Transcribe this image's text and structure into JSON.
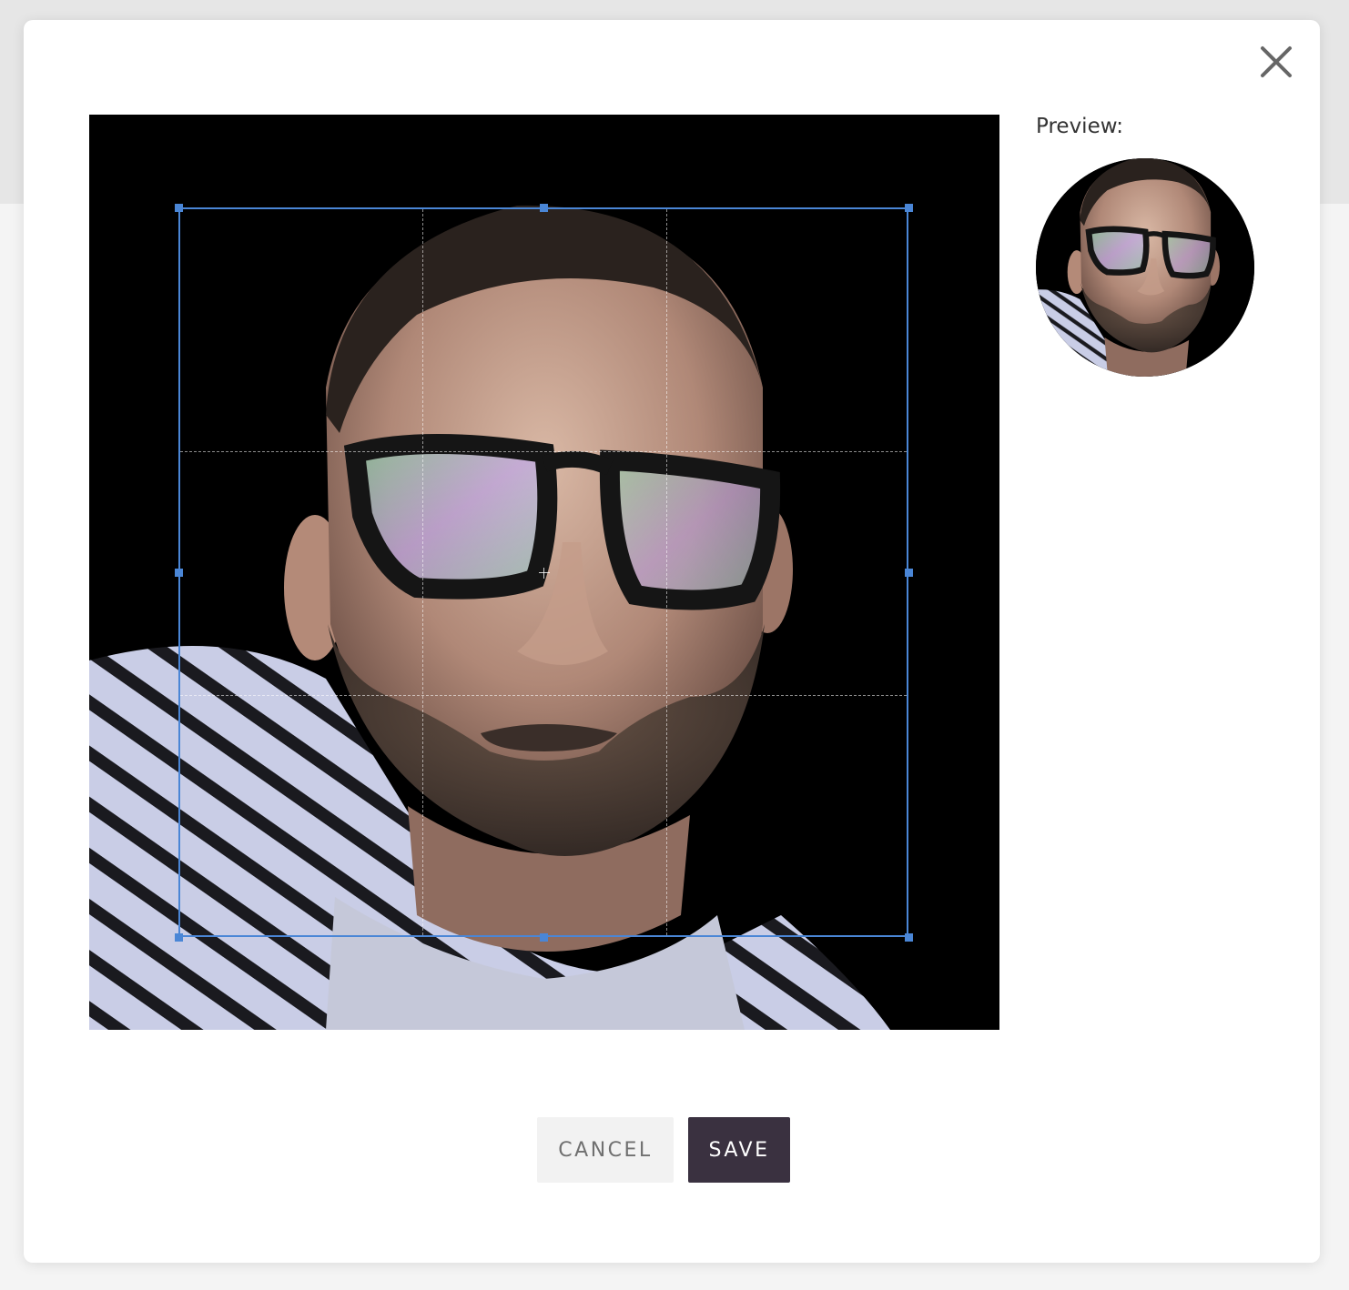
{
  "dialog": {
    "preview_label": "Preview:",
    "cancel_label": "CANCEL",
    "save_label": "SAVE"
  },
  "colors": {
    "crop_border": "#4a86d6",
    "save_button_bg": "#3a3140",
    "cancel_button_bg": "#f2f2f2"
  },
  "icons": {
    "close": "close-icon"
  }
}
